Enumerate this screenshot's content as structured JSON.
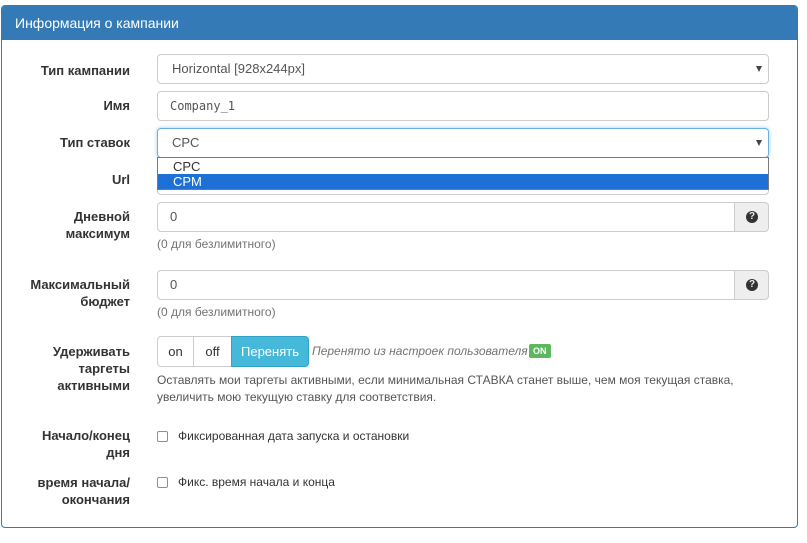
{
  "panel": {
    "title": "Информация о кампании"
  },
  "fields": {
    "campaign_type": {
      "label": "Тип кампании",
      "value": "Horizontal [928x244px]"
    },
    "name": {
      "label": "Имя",
      "value": "Company_1"
    },
    "bid_type": {
      "label": "Тип ставок",
      "value": "CPC",
      "options": [
        "CPC",
        "CPM"
      ],
      "highlighted_option": "CPM"
    },
    "url": {
      "label": "Url"
    },
    "daily_max": {
      "label_line1": "Дневной",
      "label_line2": "максимум",
      "value": "0",
      "hint": "(0 для безлимитного)"
    },
    "max_budget": {
      "label_line1": "Максимальный",
      "label_line2": "бюджет",
      "value": "0",
      "hint": "(0 для безлимитного)"
    },
    "keep_targets": {
      "label_line1": "Удерживать",
      "label_line2": "таргеты",
      "label_line3": "активными",
      "buttons": {
        "on": "on",
        "off": "off",
        "override": "Перенять"
      },
      "inherited_text": "Перенято из настроек пользователя",
      "inherited_badge": "ON",
      "description_line1": "Оставлять мои таргеты активными, если минимальная СТАВКА станет выше, чем моя текущая ставка,",
      "description_line2": "увеличить мою текущую ставку для соответствия."
    },
    "day_start_end": {
      "label_line1": "Начало/конец",
      "label_line2": "дня",
      "checkbox_label": "Фиксированная дата запуска и остановки",
      "checked": false
    },
    "time_start_end": {
      "label_line1": "время начала/",
      "label_line2": "окончания",
      "checkbox_label": "Фикс. время начала и конца",
      "checked": false
    }
  },
  "colors": {
    "primary": "#337ab7",
    "info": "#46b8da",
    "success": "#5cb85c",
    "select_highlight": "#1e70d6"
  },
  "icons": {
    "help": "question-circle-icon",
    "select_caret": "caret-down-icon"
  }
}
